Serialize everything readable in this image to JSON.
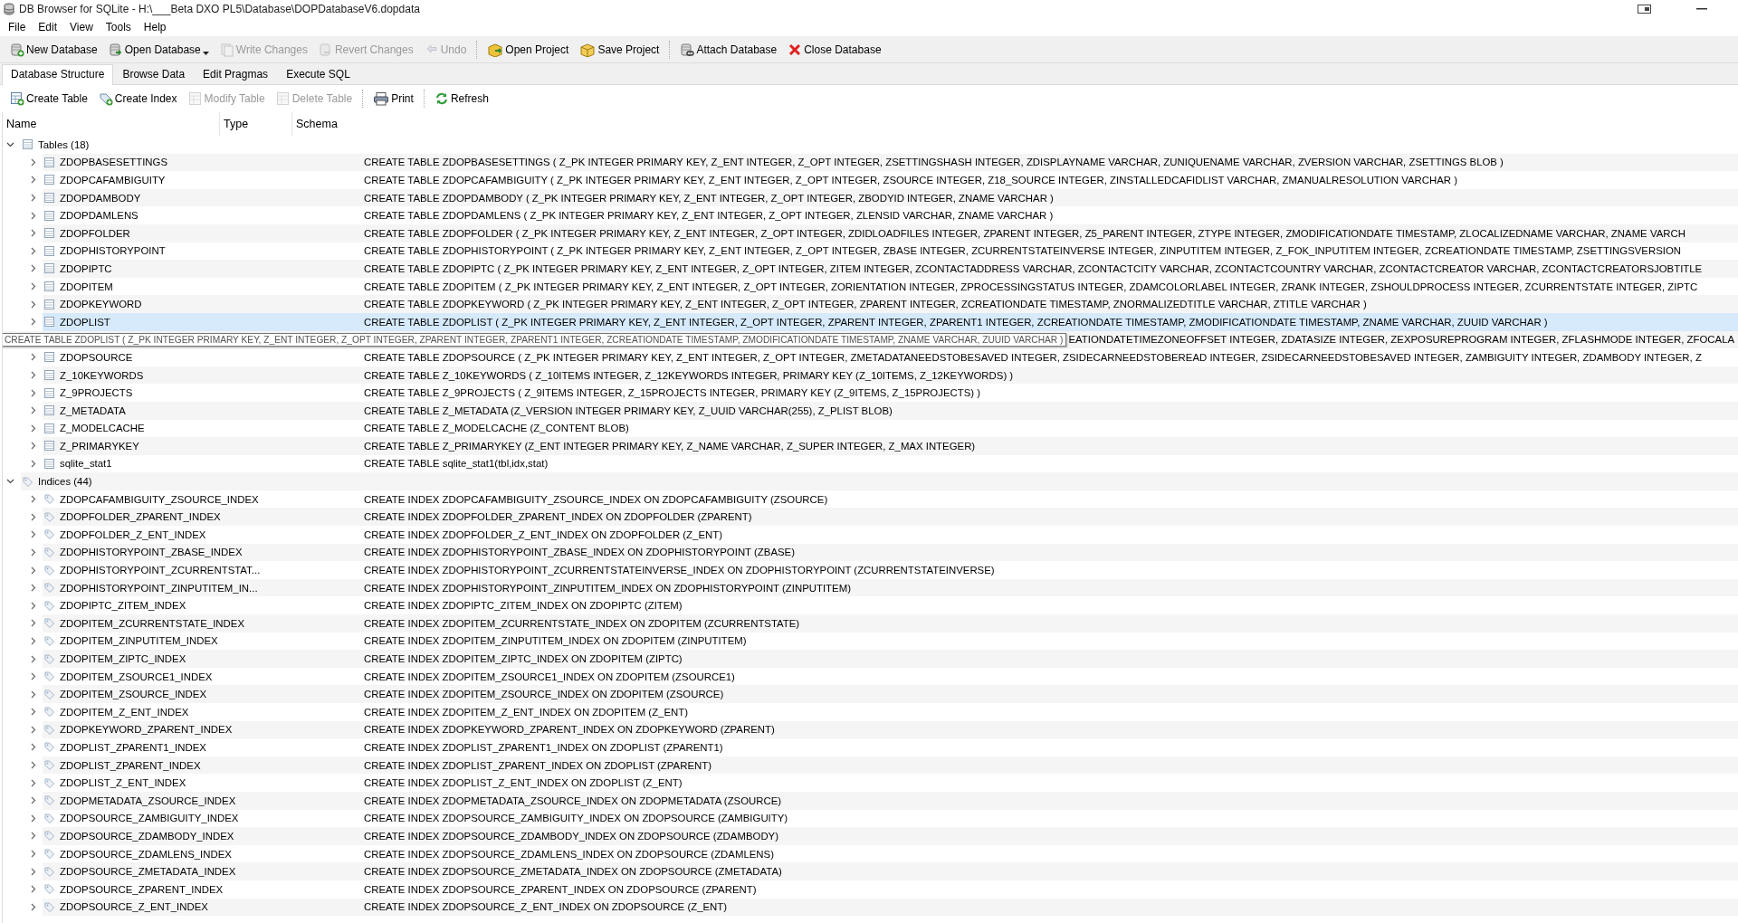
{
  "window": {
    "title": "DB Browser for SQLite - H:\\___Beta DXO PL5\\Database\\DOPDatabaseV6.dopdata"
  },
  "menu": [
    "File",
    "Edit",
    "View",
    "Tools",
    "Help"
  ],
  "toolbar": {
    "groups": [
      [
        {
          "label": "New Database",
          "disabled": false,
          "dropdown": false
        },
        {
          "label": "Open Database",
          "disabled": false,
          "dropdown": true
        },
        {
          "label": "Write Changes",
          "disabled": true,
          "dropdown": false
        },
        {
          "label": "Revert Changes",
          "disabled": true,
          "dropdown": false
        },
        {
          "label": "Undo",
          "disabled": true,
          "dropdown": false
        }
      ],
      [
        {
          "label": "Open Project",
          "disabled": false,
          "dropdown": false
        },
        {
          "label": "Save Project",
          "disabled": false,
          "dropdown": false
        }
      ],
      [
        {
          "label": "Attach Database",
          "disabled": false,
          "dropdown": false
        },
        {
          "label": "Close Database",
          "disabled": false,
          "dropdown": false
        }
      ]
    ]
  },
  "tabs": [
    {
      "label": "Database Structure",
      "selected": true
    },
    {
      "label": "Browse Data",
      "selected": false
    },
    {
      "label": "Edit Pragmas",
      "selected": false
    },
    {
      "label": "Execute SQL",
      "selected": false
    }
  ],
  "structure_toolbar": {
    "groups": [
      [
        {
          "label": "Create Table",
          "disabled": false
        },
        {
          "label": "Create Index",
          "disabled": false
        },
        {
          "label": "Modify Table",
          "disabled": true
        },
        {
          "label": "Delete Table",
          "disabled": true
        }
      ],
      [
        {
          "label": "Print",
          "disabled": false
        }
      ],
      [
        {
          "label": "Refresh",
          "disabled": false
        }
      ]
    ]
  },
  "tree": {
    "columns": [
      "Name",
      "Type",
      "Schema"
    ],
    "nodes": [
      {
        "name": "Tables (18)",
        "expanded": true,
        "children": [
          {
            "kind": "table",
            "name": "ZDOPBASESETTINGS",
            "schema": "CREATE TABLE ZDOPBASESETTINGS ( Z_PK INTEGER PRIMARY KEY, Z_ENT INTEGER, Z_OPT INTEGER, ZSETTINGSHASH INTEGER, ZDISPLAYNAME VARCHAR, ZUNIQUENAME VARCHAR, ZVERSION VARCHAR, ZSETTINGS BLOB )",
            "highlighted": false
          },
          {
            "kind": "table",
            "name": "ZDOPCAFAMBIGUITY",
            "schema": "CREATE TABLE ZDOPCAFAMBIGUITY ( Z_PK INTEGER PRIMARY KEY, Z_ENT INTEGER, Z_OPT INTEGER, ZSOURCE INTEGER, Z18_SOURCE INTEGER, ZINSTALLEDCAFIDLIST VARCHAR, ZMANUALRESOLUTION VARCHAR )",
            "highlighted": false
          },
          {
            "kind": "table",
            "name": "ZDOPDAMBODY",
            "schema": "CREATE TABLE ZDOPDAMBODY ( Z_PK INTEGER PRIMARY KEY, Z_ENT INTEGER, Z_OPT INTEGER, ZBODYID INTEGER, ZNAME VARCHAR )",
            "highlighted": false
          },
          {
            "kind": "table",
            "name": "ZDOPDAMLENS",
            "schema": "CREATE TABLE ZDOPDAMLENS ( Z_PK INTEGER PRIMARY KEY, Z_ENT INTEGER, Z_OPT INTEGER, ZLENSID VARCHAR, ZNAME VARCHAR )",
            "highlighted": false
          },
          {
            "kind": "table",
            "name": "ZDOPFOLDER",
            "schema": "CREATE TABLE ZDOPFOLDER ( Z_PK INTEGER PRIMARY KEY, Z_ENT INTEGER, Z_OPT INTEGER, ZDIDLOADFILES INTEGER, ZPARENT INTEGER, Z5_PARENT INTEGER, ZTYPE INTEGER, ZMODIFICATIONDATE TIMESTAMP, ZLOCALIZEDNAME VARCHAR, ZNAME VARCH",
            "highlighted": false
          },
          {
            "kind": "table",
            "name": "ZDOPHISTORYPOINT",
            "schema": "CREATE TABLE ZDOPHISTORYPOINT ( Z_PK INTEGER PRIMARY KEY, Z_ENT INTEGER, Z_OPT INTEGER, ZBASE INTEGER, ZCURRENTSTATEINVERSE INTEGER, ZINPUTITEM INTEGER, Z_FOK_INPUTITEM INTEGER, ZCREATIONDATE TIMESTAMP, ZSETTINGSVERSION",
            "highlighted": false
          },
          {
            "kind": "table",
            "name": "ZDOPIPTC",
            "schema": "CREATE TABLE ZDOPIPTC ( Z_PK INTEGER PRIMARY KEY, Z_ENT INTEGER, Z_OPT INTEGER, ZITEM INTEGER, ZCONTACTADDRESS VARCHAR, ZCONTACTCITY VARCHAR, ZCONTACTCOUNTRY VARCHAR, ZCONTACTCREATOR VARCHAR, ZCONTACTCREATORSJOBTITLE",
            "highlighted": false
          },
          {
            "kind": "table",
            "name": "ZDOPITEM",
            "schema": "CREATE TABLE ZDOPITEM ( Z_PK INTEGER PRIMARY KEY, Z_ENT INTEGER, Z_OPT INTEGER, ZORIENTATION INTEGER, ZPROCESSINGSTATUS INTEGER, ZDAMCOLORLABEL INTEGER, ZRANK INTEGER, ZSHOULDPROCESS INTEGER, ZCURRENTSTATE INTEGER, ZIPTC",
            "highlighted": false
          },
          {
            "kind": "table",
            "name": "ZDOPKEYWORD",
            "schema": "CREATE TABLE ZDOPKEYWORD ( Z_PK INTEGER PRIMARY KEY, Z_ENT INTEGER, Z_OPT INTEGER, ZPARENT INTEGER, ZCREATIONDATE TIMESTAMP, ZNORMALIZEDTITLE VARCHAR, ZTITLE VARCHAR )",
            "highlighted": false
          },
          {
            "kind": "table",
            "name": "ZDOPLIST",
            "schema": "CREATE TABLE ZDOPLIST ( Z_PK INTEGER PRIMARY KEY, Z_ENT INTEGER, Z_OPT INTEGER, ZPARENT INTEGER, ZPARENT1 INTEGER, ZCREATIONDATE TIMESTAMP, ZMODIFICATIONDATE TIMESTAMP, ZNAME VARCHAR, ZUUID VARCHAR )",
            "highlighted": true
          },
          {
            "kind": "covered",
            "tooltip": "CREATE TABLE ZDOPLIST ( Z_PK INTEGER PRIMARY KEY, Z_ENT INTEGER, Z_OPT INTEGER, ZPARENT INTEGER, ZPARENT1 INTEGER, ZCREATIONDATE TIMESTAMP, ZMODIFICATIONDATE TIMESTAMP, ZNAME VARCHAR, ZUUID VARCHAR )",
            "schema": "EATIONDATETIMEZONEOFFSET INTEGER, ZDATASIZE INTEGER, ZEXPOSUREPROGRAM INTEGER, ZFLASHMODE INTEGER, ZFOCALA",
            "highlighted": false
          },
          {
            "kind": "table",
            "name": "ZDOPSOURCE",
            "schema": "CREATE TABLE ZDOPSOURCE ( Z_PK INTEGER PRIMARY KEY, Z_ENT INTEGER, Z_OPT INTEGER, ZMETADATANEEDSTOBESAVED INTEGER, ZSIDECARNEEDSTOBEREAD INTEGER, ZSIDECARNEEDSTOBESAVED INTEGER, ZAMBIGUITY INTEGER, ZDAMBODY INTEGER, Z",
            "highlighted": false
          },
          {
            "kind": "table",
            "name": "Z_10KEYWORDS",
            "schema": "CREATE TABLE Z_10KEYWORDS ( Z_10ITEMS INTEGER, Z_12KEYWORDS INTEGER, PRIMARY KEY (Z_10ITEMS, Z_12KEYWORDS) )",
            "highlighted": false
          },
          {
            "kind": "table",
            "name": "Z_9PROJECTS",
            "schema": "CREATE TABLE Z_9PROJECTS ( Z_9ITEMS INTEGER, Z_15PROJECTS INTEGER, PRIMARY KEY (Z_9ITEMS, Z_15PROJECTS) )",
            "highlighted": false
          },
          {
            "kind": "table",
            "name": "Z_METADATA",
            "schema": "CREATE TABLE Z_METADATA (Z_VERSION INTEGER PRIMARY KEY, Z_UUID VARCHAR(255), Z_PLIST BLOB)",
            "highlighted": false
          },
          {
            "kind": "table",
            "name": "Z_MODELCACHE",
            "schema": "CREATE TABLE Z_MODELCACHE (Z_CONTENT BLOB)",
            "highlighted": false
          },
          {
            "kind": "table",
            "name": "Z_PRIMARYKEY",
            "schema": "CREATE TABLE Z_PRIMARYKEY (Z_ENT INTEGER PRIMARY KEY, Z_NAME VARCHAR, Z_SUPER INTEGER, Z_MAX INTEGER)",
            "highlighted": false
          },
          {
            "kind": "table",
            "name": "sqlite_stat1",
            "schema": "CREATE TABLE sqlite_stat1(tbl,idx,stat)",
            "highlighted": false
          }
        ]
      },
      {
        "name": "Indices (44)",
        "expanded": true,
        "children": [
          {
            "kind": "index",
            "name": "ZDOPCAFAMBIGUITY_ZSOURCE_INDEX",
            "schema": "CREATE INDEX ZDOPCAFAMBIGUITY_ZSOURCE_INDEX ON ZDOPCAFAMBIGUITY (ZSOURCE)"
          },
          {
            "kind": "index",
            "name": "ZDOPFOLDER_ZPARENT_INDEX",
            "schema": "CREATE INDEX ZDOPFOLDER_ZPARENT_INDEX ON ZDOPFOLDER (ZPARENT)"
          },
          {
            "kind": "index",
            "name": "ZDOPFOLDER_Z_ENT_INDEX",
            "schema": "CREATE INDEX ZDOPFOLDER_Z_ENT_INDEX ON ZDOPFOLDER (Z_ENT)"
          },
          {
            "kind": "index",
            "name": "ZDOPHISTORYPOINT_ZBASE_INDEX",
            "schema": "CREATE INDEX ZDOPHISTORYPOINT_ZBASE_INDEX ON ZDOPHISTORYPOINT (ZBASE)"
          },
          {
            "kind": "index",
            "name": "ZDOPHISTORYPOINT_ZCURRENTSTAT...",
            "schema": "CREATE INDEX ZDOPHISTORYPOINT_ZCURRENTSTATEINVERSE_INDEX ON ZDOPHISTORYPOINT (ZCURRENTSTATEINVERSE)"
          },
          {
            "kind": "index",
            "name": "ZDOPHISTORYPOINT_ZINPUTITEM_IN...",
            "schema": "CREATE INDEX ZDOPHISTORYPOINT_ZINPUTITEM_INDEX ON ZDOPHISTORYPOINT (ZINPUTITEM)"
          },
          {
            "kind": "index",
            "name": "ZDOPIPTC_ZITEM_INDEX",
            "schema": "CREATE INDEX ZDOPIPTC_ZITEM_INDEX ON ZDOPIPTC (ZITEM)"
          },
          {
            "kind": "index",
            "name": "ZDOPITEM_ZCURRENTSTATE_INDEX",
            "schema": "CREATE INDEX ZDOPITEM_ZCURRENTSTATE_INDEX ON ZDOPITEM (ZCURRENTSTATE)"
          },
          {
            "kind": "index",
            "name": "ZDOPITEM_ZINPUTITEM_INDEX",
            "schema": "CREATE INDEX ZDOPITEM_ZINPUTITEM_INDEX ON ZDOPITEM (ZINPUTITEM)"
          },
          {
            "kind": "index",
            "name": "ZDOPITEM_ZIPTC_INDEX",
            "schema": "CREATE INDEX ZDOPITEM_ZIPTC_INDEX ON ZDOPITEM (ZIPTC)"
          },
          {
            "kind": "index",
            "name": "ZDOPITEM_ZSOURCE1_INDEX",
            "schema": "CREATE INDEX ZDOPITEM_ZSOURCE1_INDEX ON ZDOPITEM (ZSOURCE1)"
          },
          {
            "kind": "index",
            "name": "ZDOPITEM_ZSOURCE_INDEX",
            "schema": "CREATE INDEX ZDOPITEM_ZSOURCE_INDEX ON ZDOPITEM (ZSOURCE)"
          },
          {
            "kind": "index",
            "name": "ZDOPITEM_Z_ENT_INDEX",
            "schema": "CREATE INDEX ZDOPITEM_Z_ENT_INDEX ON ZDOPITEM (Z_ENT)"
          },
          {
            "kind": "index",
            "name": "ZDOPKEYWORD_ZPARENT_INDEX",
            "schema": "CREATE INDEX ZDOPKEYWORD_ZPARENT_INDEX ON ZDOPKEYWORD (ZPARENT)"
          },
          {
            "kind": "index",
            "name": "ZDOPLIST_ZPARENT1_INDEX",
            "schema": "CREATE INDEX ZDOPLIST_ZPARENT1_INDEX ON ZDOPLIST (ZPARENT1)"
          },
          {
            "kind": "index",
            "name": "ZDOPLIST_ZPARENT_INDEX",
            "schema": "CREATE INDEX ZDOPLIST_ZPARENT_INDEX ON ZDOPLIST (ZPARENT)"
          },
          {
            "kind": "index",
            "name": "ZDOPLIST_Z_ENT_INDEX",
            "schema": "CREATE INDEX ZDOPLIST_Z_ENT_INDEX ON ZDOPLIST (Z_ENT)"
          },
          {
            "kind": "index",
            "name": "ZDOPMETADATA_ZSOURCE_INDEX",
            "schema": "CREATE INDEX ZDOPMETADATA_ZSOURCE_INDEX ON ZDOPMETADATA (ZSOURCE)"
          },
          {
            "kind": "index",
            "name": "ZDOPSOURCE_ZAMBIGUITY_INDEX",
            "schema": "CREATE INDEX ZDOPSOURCE_ZAMBIGUITY_INDEX ON ZDOPSOURCE (ZAMBIGUITY)"
          },
          {
            "kind": "index",
            "name": "ZDOPSOURCE_ZDAMBODY_INDEX",
            "schema": "CREATE INDEX ZDOPSOURCE_ZDAMBODY_INDEX ON ZDOPSOURCE (ZDAMBODY)"
          },
          {
            "kind": "index",
            "name": "ZDOPSOURCE_ZDAMLENS_INDEX",
            "schema": "CREATE INDEX ZDOPSOURCE_ZDAMLENS_INDEX ON ZDOPSOURCE (ZDAMLENS)"
          },
          {
            "kind": "index",
            "name": "ZDOPSOURCE_ZMETADATA_INDEX",
            "schema": "CREATE INDEX ZDOPSOURCE_ZMETADATA_INDEX ON ZDOPSOURCE (ZMETADATA)"
          },
          {
            "kind": "index",
            "name": "ZDOPSOURCE_ZPARENT_INDEX",
            "schema": "CREATE INDEX ZDOPSOURCE_ZPARENT_INDEX ON ZDOPSOURCE (ZPARENT)"
          },
          {
            "kind": "index",
            "name": "ZDOPSOURCE_Z_ENT_INDEX",
            "schema": "CREATE INDEX ZDOPSOURCE_Z_ENT_INDEX ON ZDOPSOURCE (Z_ENT)"
          }
        ]
      }
    ]
  }
}
